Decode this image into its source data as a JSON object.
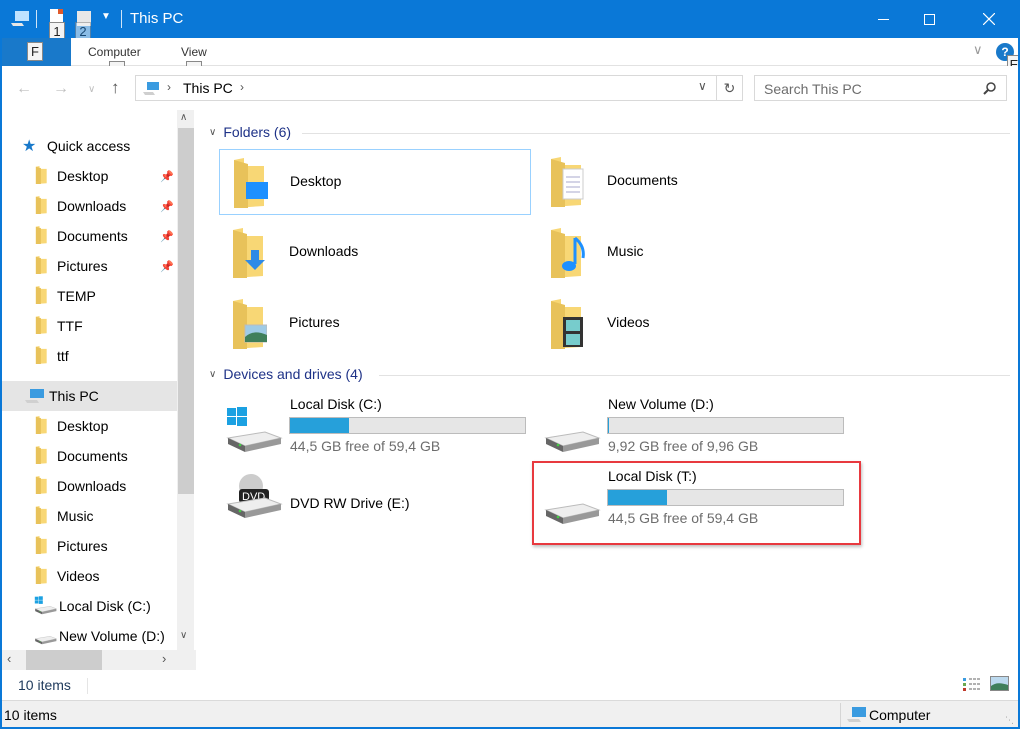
{
  "window": {
    "title": "This PC"
  },
  "keytips": {
    "qat1": "1",
    "qat2": "2",
    "file": "F",
    "computer": "C",
    "view": "V",
    "help": "E"
  },
  "ribbon": {
    "tabs": [
      {
        "label": "Computer"
      },
      {
        "label": "View"
      }
    ]
  },
  "address": {
    "crumb": "This PC",
    "search_placeholder": "Search This PC"
  },
  "nav": {
    "quick_access": {
      "label": "Quick access"
    },
    "quick_items": [
      {
        "label": "Desktop",
        "pinned": true
      },
      {
        "label": "Downloads",
        "pinned": true
      },
      {
        "label": "Documents",
        "pinned": true
      },
      {
        "label": "Pictures",
        "pinned": true
      },
      {
        "label": "TEMP",
        "pinned": false
      },
      {
        "label": "TTF",
        "pinned": false
      },
      {
        "label": "ttf",
        "pinned": false
      }
    ],
    "this_pc": {
      "label": "This PC"
    },
    "pc_items": [
      {
        "label": "Desktop"
      },
      {
        "label": "Documents"
      },
      {
        "label": "Downloads"
      },
      {
        "label": "Music"
      },
      {
        "label": "Pictures"
      },
      {
        "label": "Videos"
      },
      {
        "label": "Local Disk (C:)"
      },
      {
        "label": "New Volume (D:)"
      }
    ]
  },
  "folders": {
    "header": "Folders (6)",
    "items": [
      {
        "label": "Desktop",
        "icon": "desktop-folder-icon"
      },
      {
        "label": "Documents",
        "icon": "documents-folder-icon"
      },
      {
        "label": "Downloads",
        "icon": "downloads-folder-icon"
      },
      {
        "label": "Music",
        "icon": "music-folder-icon"
      },
      {
        "label": "Pictures",
        "icon": "pictures-folder-icon"
      },
      {
        "label": "Videos",
        "icon": "videos-folder-icon"
      }
    ]
  },
  "drives": {
    "header": "Devices and drives (4)",
    "items": [
      {
        "label": "Local Disk (C:)",
        "free": "44,5 GB free of 59,4 GB",
        "used_fraction": 0.25
      },
      {
        "label": "New Volume (D:)",
        "free": "9,92 GB free of 9,96 GB",
        "used_fraction": 0.004
      },
      {
        "label": "DVD RW Drive (E:)"
      },
      {
        "label": "Local Disk (T:)",
        "free": "44,5 GB free of 59,4 GB",
        "used_fraction": 0.25
      }
    ]
  },
  "status": {
    "inner_count": "10 items",
    "bar_count": "10 items",
    "location": "Computer"
  },
  "colors": {
    "accent": "#0a78d7",
    "bar_fill": "#26a0da",
    "highlight": "#e8393f"
  }
}
